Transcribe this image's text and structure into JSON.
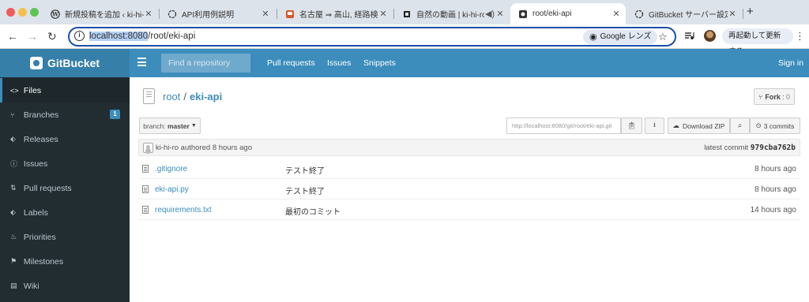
{
  "browser": {
    "tabs": [
      {
        "title": "新規投稿を追加 ‹ ki-hi-ro",
        "icon": "wordpress-icon"
      },
      {
        "title": "API利用例説明",
        "icon": "openai-icon"
      },
      {
        "title": "名古屋 ⇒ 高山, 経路検索|",
        "icon": "train-icon"
      },
      {
        "title": "自然の動画 | ki-hi-ro.n",
        "icon": "github-icon"
      },
      {
        "title": "root/eki-api",
        "icon": "gitbucket-icon"
      },
      {
        "title": "GitBucket サーバー設定",
        "icon": "openai-icon"
      }
    ],
    "address": {
      "host": "localhost:8080",
      "path": "/root/eki-api"
    },
    "lens_label": "Google レンズ",
    "relaunch_label": "再起動して更新する"
  },
  "gitbucket": {
    "brand": "GitBucket",
    "search_placeholder": "Find a repository",
    "nav": [
      "Pull requests",
      "Issues",
      "Snippets"
    ],
    "signin": "Sign in"
  },
  "sidebar": {
    "items": [
      {
        "label": "Files",
        "icon": "code-icon",
        "active": true
      },
      {
        "label": "Branches",
        "icon": "branch-icon",
        "badge": "1"
      },
      {
        "label": "Releases",
        "icon": "tag-icon"
      },
      {
        "label": "Issues",
        "icon": "issue-icon"
      },
      {
        "label": "Pull requests",
        "icon": "pull-request-icon"
      },
      {
        "label": "Labels",
        "icon": "label-icon"
      },
      {
        "label": "Priorities",
        "icon": "flame-icon"
      },
      {
        "label": "Milestones",
        "icon": "milestone-icon"
      },
      {
        "label": "Wiki",
        "icon": "book-icon"
      }
    ]
  },
  "repo": {
    "owner": "root",
    "separator": "/",
    "name": "eki-api",
    "fork_label": "Fork",
    "fork_count": "0",
    "branch_prefix": "branch:",
    "branch": "master",
    "clone_url": "http://localhost:8080/git/root/eki-api.git",
    "download_label": "Download ZIP",
    "commits_label": "3 commits",
    "author": "ki-hi-ro",
    "authored_text": "authored 8 hours ago",
    "latest_commit_label": "latest commit",
    "latest_commit_hash": "979cba762b",
    "files": [
      {
        "name": ".gitignore",
        "message": "テスト終了",
        "age": "8 hours ago"
      },
      {
        "name": "eki-api.py",
        "message": "テスト終了",
        "age": "8 hours ago"
      },
      {
        "name": "requirements.txt",
        "message": "最初のコミット",
        "age": "14 hours ago"
      }
    ]
  },
  "colors": {
    "header": "#3c8dbc",
    "brand_bg": "#367fa9",
    "sidebar": "#222d32",
    "link": "#3c8dbc"
  }
}
